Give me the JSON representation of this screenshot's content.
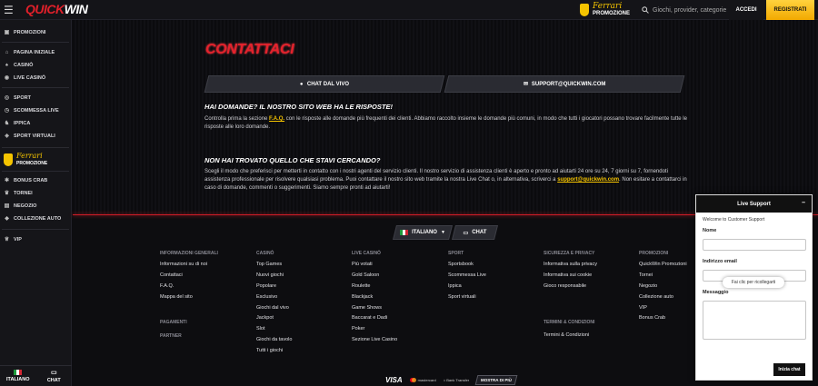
{
  "header": {
    "logo_a": "QUICK",
    "logo_b": "WIN",
    "promo_brand": "Ferrari",
    "promo_label": "PROMOZIONE",
    "search_placeholder": "Giochi, provider, categorie",
    "login_label": "ACCEDI",
    "register_label": "REGISTRATI"
  },
  "sidebar": {
    "items": [
      {
        "label": "PROMOZIONI",
        "icon": "gift-icon"
      },
      {
        "label": "PAGINA INIZIALE",
        "icon": "home-icon"
      },
      {
        "label": "CASINÒ",
        "icon": "cards-icon"
      },
      {
        "label": "LIVE CASINÒ",
        "icon": "live-icon"
      },
      {
        "label": "SPORT",
        "icon": "ball-icon"
      },
      {
        "label": "SCOMMESSA LIVE",
        "icon": "stopwatch-icon"
      },
      {
        "label": "IPPICA",
        "icon": "horse-icon"
      },
      {
        "label": "SPORT VIRTUALI",
        "icon": "gamepad-icon"
      },
      {
        "label": "BONUS CRAB",
        "icon": "crab-icon"
      },
      {
        "label": "TORNEI",
        "icon": "trophy-icon"
      },
      {
        "label": "NEGOZIO",
        "icon": "shop-icon"
      },
      {
        "label": "COLLEZIONE AUTO",
        "icon": "car-icon"
      },
      {
        "label": "VIP",
        "icon": "crown-icon"
      }
    ],
    "promo_brand": "Ferrari",
    "promo_label": "PROMOZIONE",
    "language_label": "ITALIANO",
    "chat_label": "CHAT"
  },
  "main": {
    "title": "CONTATTACI",
    "live_chat_label": "CHAT DAL VIVO",
    "email_label": "SUPPORT@QUICKWIN.COM",
    "q1": "HAI DOMANDE? IL NOSTRO SITO WEB HA LE RISPOSTE!",
    "p1_a": "Controlla prima la sezione ",
    "p1_link": "F.A.Q.",
    "p1_b": " con le risposte alle domande più frequenti dei clienti. Abbiamo raccolto insieme le domande più comuni, in modo che tutti i giocatori possano trovare facilmente tutte le risposte alle loro domande.",
    "q2": "NON HAI TROVATO QUELLO CHE STAVI CERCANDO?",
    "p2_a": "Scegli il modo che preferisci per metterti in contatto con i nostri agenti del servizio clienti. Il nostro servizio di assistenza clienti è aperto e pronto ad aiutarti 24 ore su 24, 7 giorni su 7, fornendoti assistenza professionale per risolvere qualsiasi problema. Puoi contattare il nostro sito web tramite la nostra Live Chat o, in alternativa, scriverci a ",
    "p2_link": "support@quickwin.com",
    "p2_b": ". Non esitare a contattarci in caso di domande, commenti o suggerimenti. Siamo sempre pronti ad aiutarti!"
  },
  "footer": {
    "language_label": "ITALIANO",
    "chat_label": "CHAT",
    "columns": [
      {
        "head": "INFORMAZIONI GENERALI",
        "links": [
          "Informazioni su di noi",
          "Contattaci",
          "F.A.Q.",
          "Mappa del sito"
        ]
      },
      {
        "head": "CASINÒ",
        "links": [
          "Top Games",
          "Nuovi giochi",
          "Popolare",
          "Esclusivo",
          "Giochi dal vivo",
          "Jackpot",
          "Slot",
          "Giochi da tavolo",
          "Tutti i giochi"
        ]
      },
      {
        "head": "LIVE CASINÒ",
        "links": [
          "Più votati",
          "Gold Saloon",
          "Roulette",
          "Blackjack",
          "Game Shows",
          "Baccarat e Dadi",
          "Poker",
          "Sezione Live Casino"
        ]
      },
      {
        "head": "SPORT",
        "links": [
          "Sportsbook",
          "Scommessa Live",
          "Ippica",
          "Sport virtuali"
        ]
      },
      {
        "head": "SICUREZZA E PRIVACY",
        "links": [
          "Informativa sulla privacy",
          "Informativa sui cookie",
          "Gioco responsabile"
        ]
      },
      {
        "head": "PROMOZIONI",
        "links": [
          "QuickWin Promozioni",
          "Tornei",
          "Negozio",
          "Collezione auto",
          "VIP",
          "Bonus Crab"
        ]
      }
    ],
    "payments_head": "PAGAMENTI",
    "partner_head": "PARTNER",
    "terms_head": "TERMINI & CONDIZIONI",
    "terms_link": "Termini & Condizioni",
    "visa": "VISA",
    "mastercard": "mastercard",
    "bank": "Bank Transfer",
    "show_more": "MOSTRA DI PIÙ"
  },
  "live_support": {
    "title": "Live Support",
    "minimize": "–",
    "welcome": "Welcome to Customer Support",
    "name_label": "Nome",
    "email_label": "Indirizzo email",
    "tooltip": "Fai clic per ricollegarti",
    "message_label": "Messaggio",
    "start_button": "Inizia chat"
  }
}
